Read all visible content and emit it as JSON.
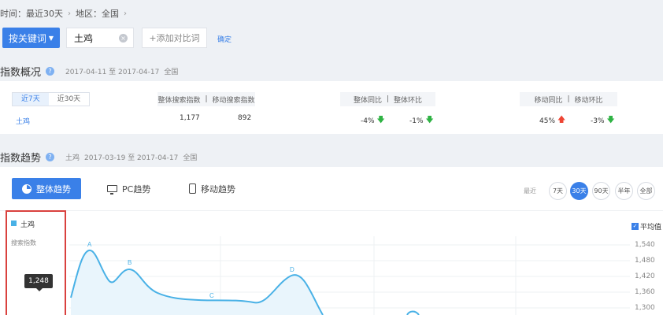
{
  "filter": {
    "time_label": "时间：最近30天",
    "region_label": "地区：全国",
    "keyword_button": "按关键词",
    "keyword_value": "土鸡",
    "add_compare": "+添加对比词",
    "confirm": "确定"
  },
  "overview": {
    "title": "指数概况",
    "date_range": "2017-04-11 至 2017-04-17",
    "region": "全国",
    "tabs": [
      "近7天",
      "近30天"
    ],
    "header_search": "整体搜索指数",
    "header_mobile": "移动搜索指数",
    "header_overall_yoy": "整体同比",
    "header_overall_mom": "整体环比",
    "header_mobile_yoy": "移动同比",
    "header_mobile_mom": "移动环比",
    "sep": "|",
    "keyword": "土鸡",
    "search_index": "1,177",
    "mobile_index": "892",
    "overall_yoy": "-4%",
    "overall_mom": "-1%",
    "mobile_yoy": "45%",
    "mobile_mom": "-3%",
    "arrows": {
      "overall_yoy": "down",
      "overall_mom": "down",
      "mobile_yoy": "up",
      "mobile_mom": "down"
    }
  },
  "trend": {
    "title": "指数趋势",
    "keyword": "土鸡",
    "date_range": "2017-03-19 至 2017-04-17",
    "region": "全国",
    "tabs": [
      "整体趋势",
      "PC趋势",
      "移动趋势"
    ],
    "recent_label": "最近",
    "ranges": [
      "7天",
      "30天",
      "90天",
      "半年",
      "全部"
    ],
    "selected_range": "30天",
    "legend_name": "土鸡",
    "legend_sub": "搜索指数",
    "tooltip_value": "1,248",
    "average_label": "平均值",
    "average_checked": true
  },
  "chart_data": {
    "type": "area",
    "y_ticks": [
      "1,540",
      "1,480",
      "1,420",
      "1,360",
      "1,300"
    ],
    "annotations": [
      "A",
      "B",
      "C",
      "D"
    ],
    "series": [
      {
        "name": "土鸡",
        "color": "#49b1e6"
      }
    ]
  },
  "colors": {
    "accent": "#3a80e8",
    "series": "#49b1e6",
    "up": "#ee4433",
    "down": "#2fb344",
    "highlight_box": "#d9413e"
  }
}
